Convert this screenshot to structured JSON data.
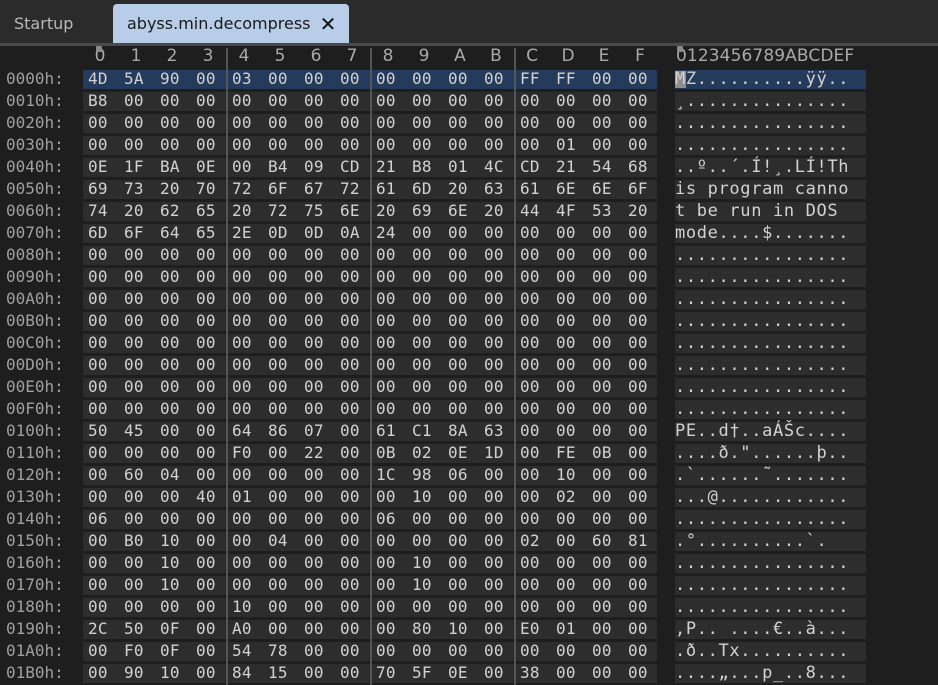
{
  "tabs": [
    {
      "label": "Startup",
      "active": false
    },
    {
      "label": "abyss.min.decompress",
      "active": true,
      "close": "✕"
    }
  ],
  "columns": [
    "0",
    "1",
    "2",
    "3",
    "4",
    "5",
    "6",
    "7",
    "8",
    "9",
    "A",
    "B",
    "C",
    "D",
    "E",
    "F"
  ],
  "ascii_header": "0123456789ABCDEF",
  "rows": [
    {
      "offset": "0000h:",
      "bytes": [
        "4D",
        "5A",
        "90",
        "00",
        "03",
        "00",
        "00",
        "00",
        "00",
        "00",
        "00",
        "00",
        "FF",
        "FF",
        "00",
        "00"
      ],
      "ascii": "MZ..........ÿÿ..",
      "selected": true
    },
    {
      "offset": "0010h:",
      "bytes": [
        "B8",
        "00",
        "00",
        "00",
        "00",
        "00",
        "00",
        "00",
        "00",
        "00",
        "00",
        "00",
        "00",
        "00",
        "00",
        "00"
      ],
      "ascii": "¸..............."
    },
    {
      "offset": "0020h:",
      "bytes": [
        "00",
        "00",
        "00",
        "00",
        "00",
        "00",
        "00",
        "00",
        "00",
        "00",
        "00",
        "00",
        "00",
        "00",
        "00",
        "00"
      ],
      "ascii": "................"
    },
    {
      "offset": "0030h:",
      "bytes": [
        "00",
        "00",
        "00",
        "00",
        "00",
        "00",
        "00",
        "00",
        "00",
        "00",
        "00",
        "00",
        "00",
        "01",
        "00",
        "00"
      ],
      "ascii": "................"
    },
    {
      "offset": "0040h:",
      "bytes": [
        "0E",
        "1F",
        "BA",
        "0E",
        "00",
        "B4",
        "09",
        "CD",
        "21",
        "B8",
        "01",
        "4C",
        "CD",
        "21",
        "54",
        "68"
      ],
      "ascii": "..º..´.Í!¸.LÍ!Th"
    },
    {
      "offset": "0050h:",
      "bytes": [
        "69",
        "73",
        "20",
        "70",
        "72",
        "6F",
        "67",
        "72",
        "61",
        "6D",
        "20",
        "63",
        "61",
        "6E",
        "6E",
        "6F"
      ],
      "ascii": "is program canno"
    },
    {
      "offset": "0060h:",
      "bytes": [
        "74",
        "20",
        "62",
        "65",
        "20",
        "72",
        "75",
        "6E",
        "20",
        "69",
        "6E",
        "20",
        "44",
        "4F",
        "53",
        "20"
      ],
      "ascii": "t be run in DOS "
    },
    {
      "offset": "0070h:",
      "bytes": [
        "6D",
        "6F",
        "64",
        "65",
        "2E",
        "0D",
        "0D",
        "0A",
        "24",
        "00",
        "00",
        "00",
        "00",
        "00",
        "00",
        "00"
      ],
      "ascii": "mode....$......."
    },
    {
      "offset": "0080h:",
      "bytes": [
        "00",
        "00",
        "00",
        "00",
        "00",
        "00",
        "00",
        "00",
        "00",
        "00",
        "00",
        "00",
        "00",
        "00",
        "00",
        "00"
      ],
      "ascii": "................"
    },
    {
      "offset": "0090h:",
      "bytes": [
        "00",
        "00",
        "00",
        "00",
        "00",
        "00",
        "00",
        "00",
        "00",
        "00",
        "00",
        "00",
        "00",
        "00",
        "00",
        "00"
      ],
      "ascii": "................"
    },
    {
      "offset": "00A0h:",
      "bytes": [
        "00",
        "00",
        "00",
        "00",
        "00",
        "00",
        "00",
        "00",
        "00",
        "00",
        "00",
        "00",
        "00",
        "00",
        "00",
        "00"
      ],
      "ascii": "................"
    },
    {
      "offset": "00B0h:",
      "bytes": [
        "00",
        "00",
        "00",
        "00",
        "00",
        "00",
        "00",
        "00",
        "00",
        "00",
        "00",
        "00",
        "00",
        "00",
        "00",
        "00"
      ],
      "ascii": "................"
    },
    {
      "offset": "00C0h:",
      "bytes": [
        "00",
        "00",
        "00",
        "00",
        "00",
        "00",
        "00",
        "00",
        "00",
        "00",
        "00",
        "00",
        "00",
        "00",
        "00",
        "00"
      ],
      "ascii": "................"
    },
    {
      "offset": "00D0h:",
      "bytes": [
        "00",
        "00",
        "00",
        "00",
        "00",
        "00",
        "00",
        "00",
        "00",
        "00",
        "00",
        "00",
        "00",
        "00",
        "00",
        "00"
      ],
      "ascii": "................"
    },
    {
      "offset": "00E0h:",
      "bytes": [
        "00",
        "00",
        "00",
        "00",
        "00",
        "00",
        "00",
        "00",
        "00",
        "00",
        "00",
        "00",
        "00",
        "00",
        "00",
        "00"
      ],
      "ascii": "................"
    },
    {
      "offset": "00F0h:",
      "bytes": [
        "00",
        "00",
        "00",
        "00",
        "00",
        "00",
        "00",
        "00",
        "00",
        "00",
        "00",
        "00",
        "00",
        "00",
        "00",
        "00"
      ],
      "ascii": "................"
    },
    {
      "offset": "0100h:",
      "bytes": [
        "50",
        "45",
        "00",
        "00",
        "64",
        "86",
        "07",
        "00",
        "61",
        "C1",
        "8A",
        "63",
        "00",
        "00",
        "00",
        "00"
      ],
      "ascii": "PE..d†..aÁŠc...."
    },
    {
      "offset": "0110h:",
      "bytes": [
        "00",
        "00",
        "00",
        "00",
        "F0",
        "00",
        "22",
        "00",
        "0B",
        "02",
        "0E",
        "1D",
        "00",
        "FE",
        "0B",
        "00"
      ],
      "ascii": "....ð.\"......þ.."
    },
    {
      "offset": "0120h:",
      "bytes": [
        "00",
        "60",
        "04",
        "00",
        "00",
        "00",
        "00",
        "00",
        "1C",
        "98",
        "06",
        "00",
        "00",
        "10",
        "00",
        "00"
      ],
      "ascii": ".`......˜......."
    },
    {
      "offset": "0130h:",
      "bytes": [
        "00",
        "00",
        "00",
        "40",
        "01",
        "00",
        "00",
        "00",
        "00",
        "10",
        "00",
        "00",
        "00",
        "02",
        "00",
        "00"
      ],
      "ascii": "...@............"
    },
    {
      "offset": "0140h:",
      "bytes": [
        "06",
        "00",
        "00",
        "00",
        "00",
        "00",
        "00",
        "00",
        "06",
        "00",
        "00",
        "00",
        "00",
        "00",
        "00",
        "00"
      ],
      "ascii": "................"
    },
    {
      "offset": "0150h:",
      "bytes": [
        "00",
        "B0",
        "10",
        "00",
        "00",
        "04",
        "00",
        "00",
        "00",
        "00",
        "00",
        "00",
        "02",
        "00",
        "60",
        "81"
      ],
      "ascii": ".°..........`."
    },
    {
      "offset": "0160h:",
      "bytes": [
        "00",
        "00",
        "10",
        "00",
        "00",
        "00",
        "00",
        "00",
        "00",
        "10",
        "00",
        "00",
        "00",
        "00",
        "00",
        "00"
      ],
      "ascii": "................"
    },
    {
      "offset": "0170h:",
      "bytes": [
        "00",
        "00",
        "10",
        "00",
        "00",
        "00",
        "00",
        "00",
        "00",
        "10",
        "00",
        "00",
        "00",
        "00",
        "00",
        "00"
      ],
      "ascii": "................"
    },
    {
      "offset": "0180h:",
      "bytes": [
        "00",
        "00",
        "00",
        "00",
        "10",
        "00",
        "00",
        "00",
        "00",
        "00",
        "00",
        "00",
        "00",
        "00",
        "00",
        "00"
      ],
      "ascii": "................"
    },
    {
      "offset": "0190h:",
      "bytes": [
        "2C",
        "50",
        "0F",
        "00",
        "A0",
        "00",
        "00",
        "00",
        "00",
        "80",
        "10",
        "00",
        "E0",
        "01",
        "00",
        "00"
      ],
      "ascii": ",P.. ....€..à..."
    },
    {
      "offset": "01A0h:",
      "bytes": [
        "00",
        "F0",
        "0F",
        "00",
        "54",
        "78",
        "00",
        "00",
        "00",
        "00",
        "00",
        "00",
        "00",
        "00",
        "00",
        "00"
      ],
      "ascii": ".ð..Tx.........."
    },
    {
      "offset": "01B0h:",
      "bytes": [
        "00",
        "90",
        "10",
        "00",
        "84",
        "15",
        "00",
        "00",
        "70",
        "5F",
        "0E",
        "00",
        "38",
        "00",
        "00",
        "00"
      ],
      "ascii": "....„...p_..8..."
    }
  ]
}
